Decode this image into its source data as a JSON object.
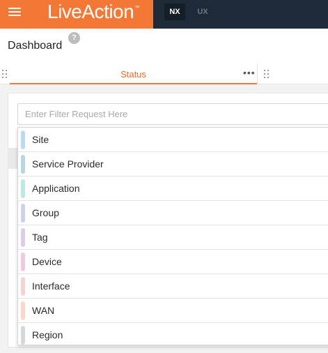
{
  "app": {
    "logo_text": "LiveAction",
    "logo_mark": "™",
    "brand_color": "#f37735",
    "menu_icon": "hamburger-menu-icon",
    "tabs": [
      {
        "label": "NX",
        "active": true
      },
      {
        "label": "UX",
        "active": false
      }
    ]
  },
  "header": {
    "title": "Dashboard",
    "help_icon": "?"
  },
  "tabstrip": {
    "active_tab": "Status",
    "more_icon": "•••"
  },
  "filter": {
    "placeholder": "Enter Filter Request Here",
    "value": ""
  },
  "dropdown": {
    "items": [
      {
        "label": "Site",
        "color": "#b9dcf3"
      },
      {
        "label": "Service Provider",
        "color": "#b5d6e2"
      },
      {
        "label": "Application",
        "color": "#bde8e3"
      },
      {
        "label": "Group",
        "color": "#ccd1ee"
      },
      {
        "label": "Tag",
        "color": "#dccdeb"
      },
      {
        "label": "Device",
        "color": "#f0c8df"
      },
      {
        "label": "Interface",
        "color": "#f8d1d3"
      },
      {
        "label": "WAN",
        "color": "#f9d8c6"
      },
      {
        "label": "Region",
        "color": "#d3d8dd"
      }
    ]
  }
}
